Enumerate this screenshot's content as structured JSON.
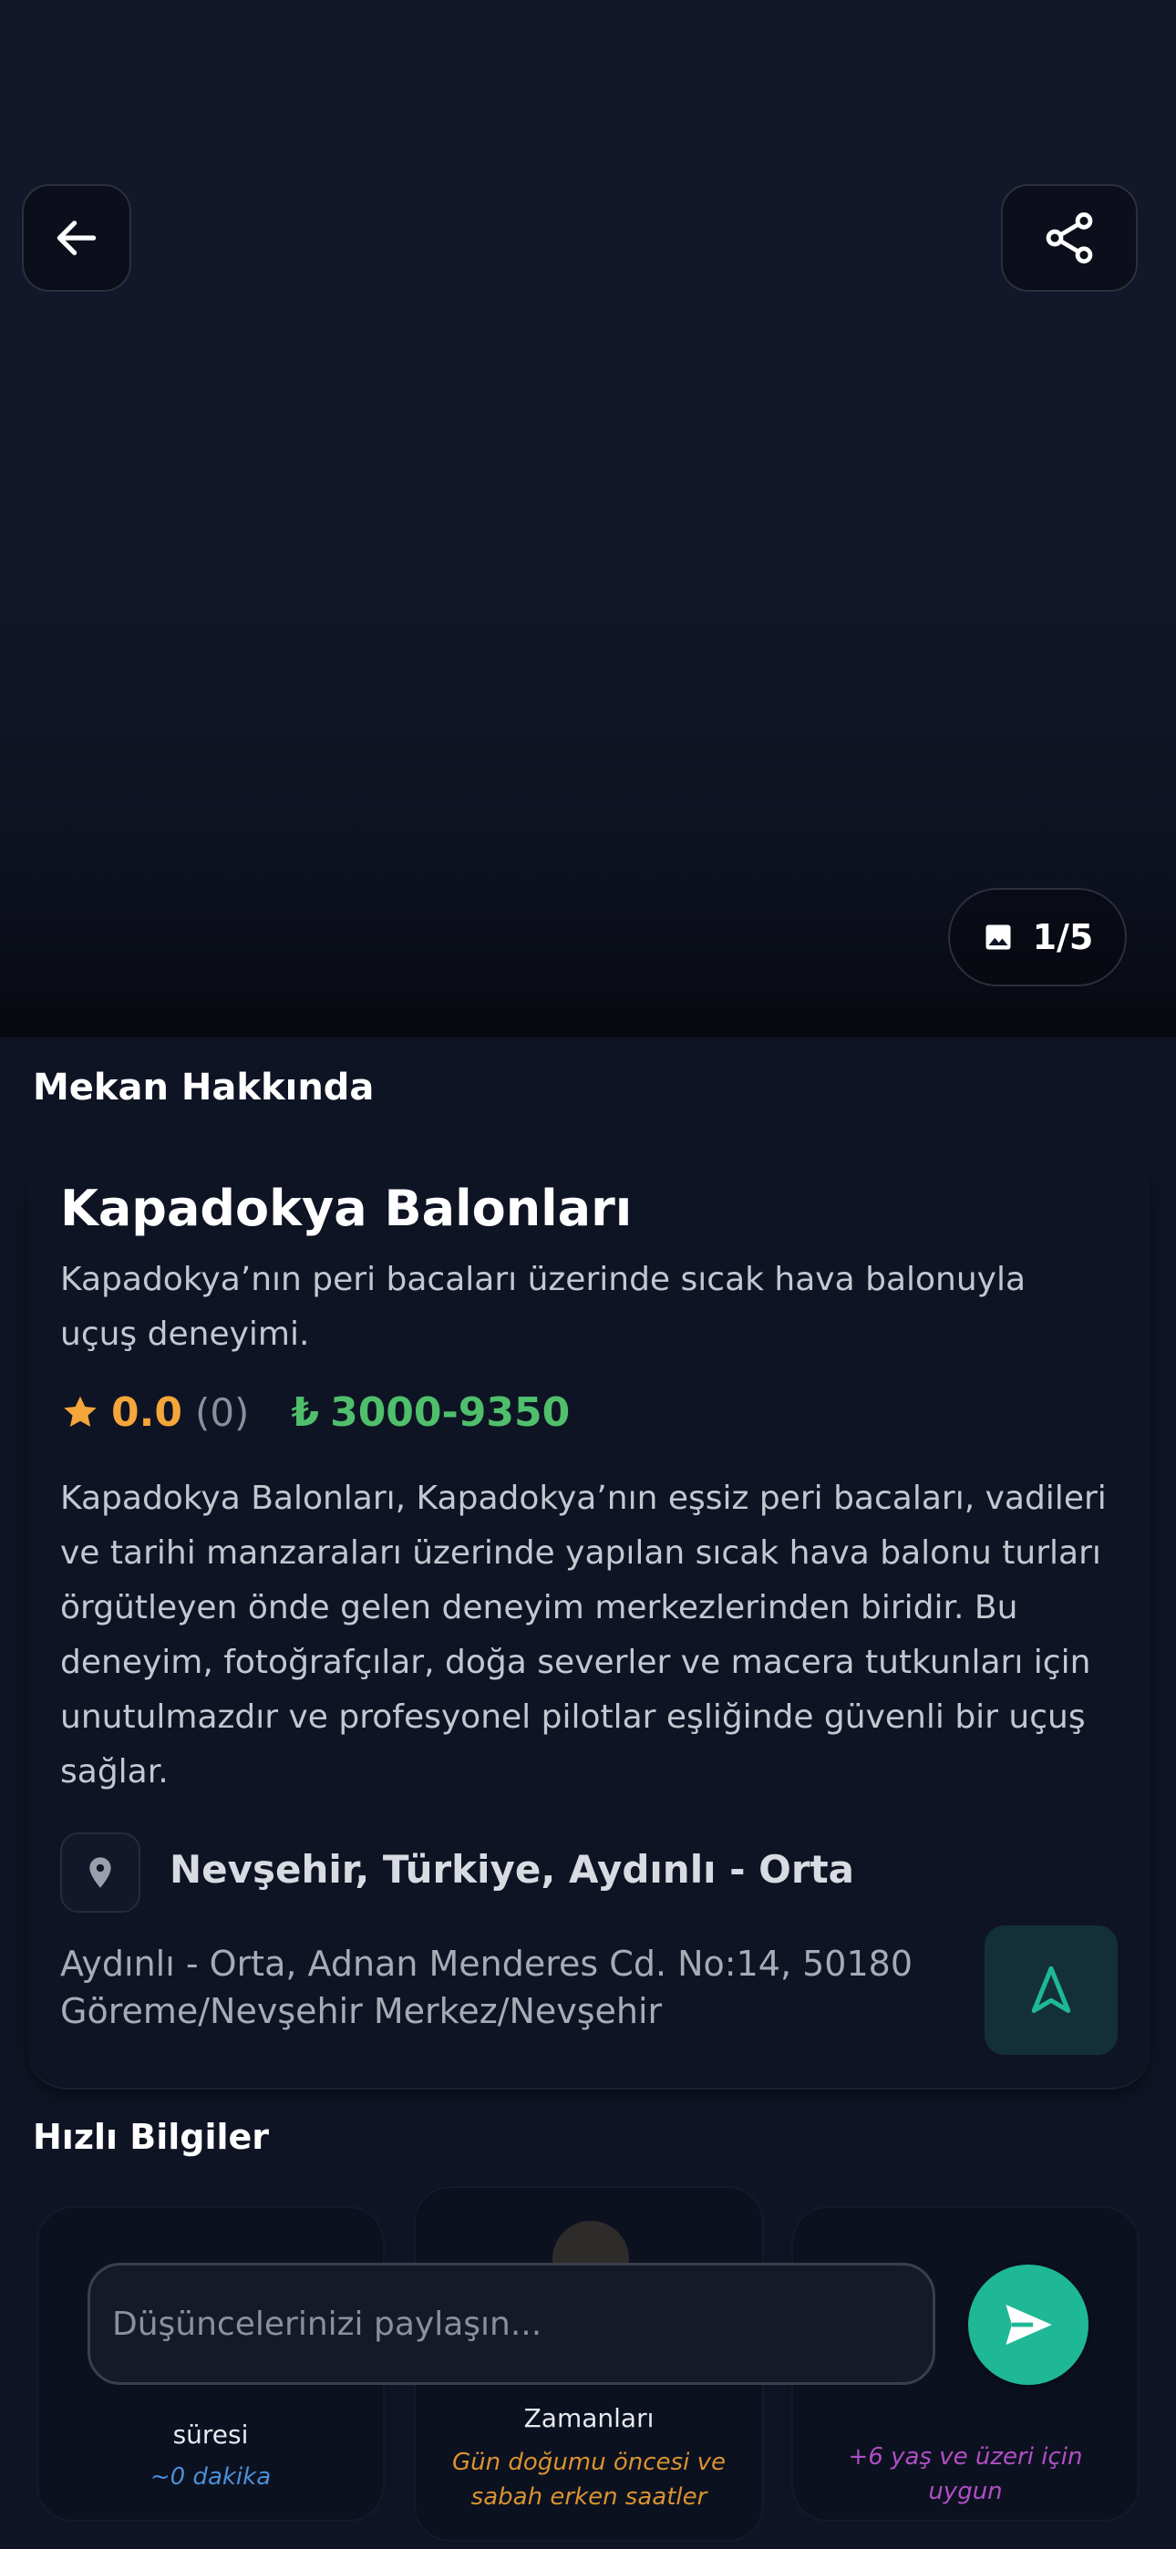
{
  "gallery": {
    "counter": "1/5"
  },
  "about": {
    "section_title": "Mekan Hakkında",
    "name": "Kapadokya Balonları",
    "short_description": "Kapadokya’nın peri bacaları üzerinde sıcak hava balonuyla uçuş deneyimi.",
    "rating": "0.0",
    "rating_count": "(0)",
    "currency_symbol": "₺",
    "price_range": "3000-9350",
    "description": "Kapadokya Balonları, Kapadokya’nın eşsiz peri bacaları, vadileri ve tarihi manzaraları üzerinde yapılan sıcak hava balonu turları örgütleyen önde gelen deneyim merkezlerinden biridir. Bu deneyim, fotoğrafçılar, doğa severler ve macera tutkunları için unutulmazdır ve profesyonel pilotlar eşliğinde güvenli bir uçuş sağlar.",
    "location_title": "Nevşehir, Türkiye, Aydınlı - Orta",
    "address": "Aydınlı - Orta, Adnan Menderes Cd. No:14, 50180 Göreme/Nevşehir Merkez/Nevşehir"
  },
  "quick_info": {
    "section_title": "Hızlı Bilgiler",
    "cards": [
      {
        "label": "süresi",
        "sub": "~0 dakika",
        "color": "#4a8fd6"
      },
      {
        "label": "Zamanları",
        "sub": "Gün doğumu öncesi ve sabah erken saatler",
        "color": "#d9932f"
      },
      {
        "label": "",
        "sub": "+6 yaş ve üzeri için uygun",
        "color": "#b04fc4"
      }
    ]
  },
  "composer": {
    "placeholder": "Düşüncelerinizi paylaşın..."
  },
  "colors": {
    "background": "#0f1424",
    "rating": "#f4a63a",
    "price": "#4fbf6c",
    "accent": "#1fb896"
  }
}
